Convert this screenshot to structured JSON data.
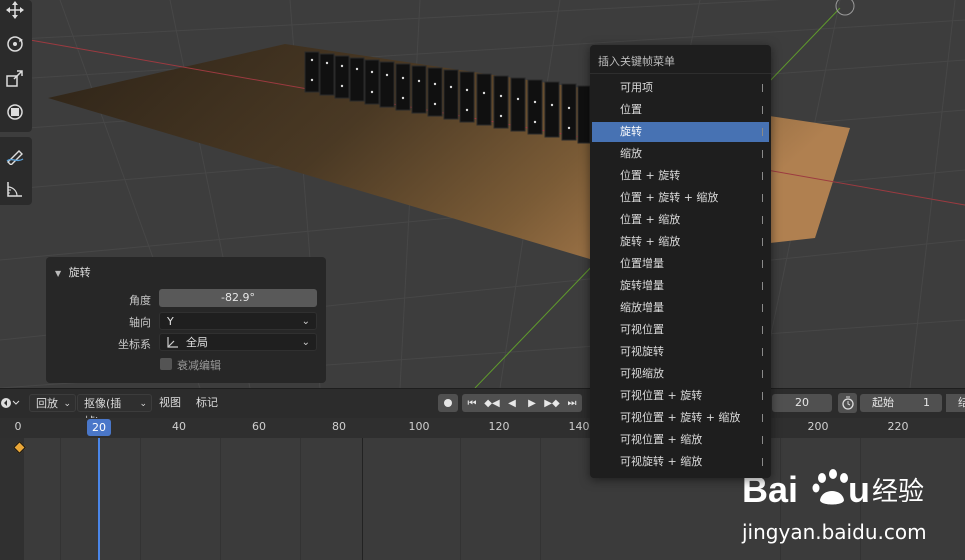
{
  "operator_panel": {
    "title": "旋转",
    "angle_label": "角度",
    "angle_value": "-82.9°",
    "axis_label": "轴向",
    "axis_value": "Y",
    "coord_label": "坐标系",
    "coord_value": "全局",
    "proportional_label": "衰减编辑"
  },
  "menu": {
    "title": "插入关键帧菜单",
    "selected_index": 2,
    "items": [
      "可用项",
      "位置",
      "旋转",
      "缩放",
      "位置 + 旋转",
      "位置 + 旋转 + 缩放",
      "位置 + 缩放",
      "旋转 + 缩放",
      "位置增量",
      "旋转增量",
      "缩放增量",
      "可视位置",
      "可视旋转",
      "可视缩放",
      "可视位置 + 旋转",
      "可视位置 + 旋转 + 缩放",
      "可视位置 + 缩放",
      "可视旋转 + 缩放"
    ]
  },
  "timeline": {
    "playback_label": "回放",
    "keying_label": "抠像(插帧)",
    "view_label": "视图",
    "marker_label": "标记",
    "current_frame": "20",
    "start_label": "起始",
    "start_value": "1",
    "end_partial": "结",
    "current_frame_indicator": "20",
    "ruler_ticks": [
      "0",
      "40",
      "60",
      "80",
      "100",
      "120",
      "140",
      "200",
      "220"
    ]
  },
  "watermark": {
    "text": "jingyan.baidu.com"
  },
  "colors": {
    "accent": "#4772b3",
    "playhead": "#4a86e8",
    "keyframe": "#e9a638",
    "x_axis": "#c9424a",
    "y_axis": "#6aa52f"
  }
}
